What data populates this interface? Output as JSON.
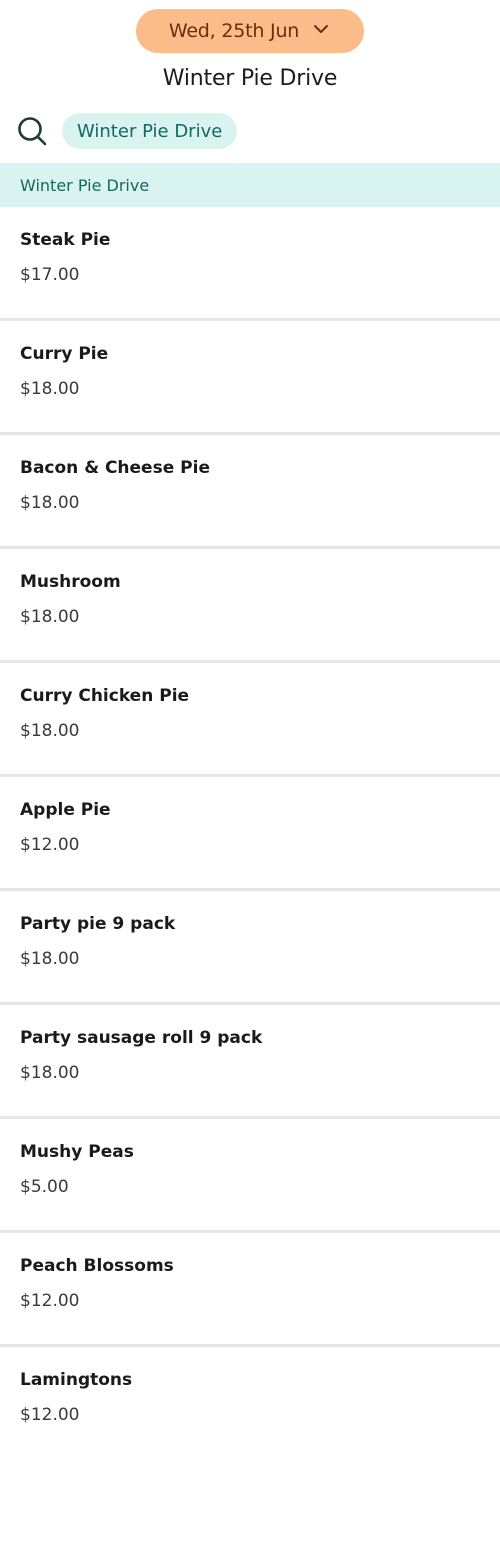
{
  "colors": {
    "date_pill_bg": "#fbbc8a",
    "date_pill_text": "#6b2e0c",
    "chip_bg": "#d8f3f0",
    "chip_text": "#16685e",
    "section_bg": "#d8f3f0",
    "section_text": "#16685e",
    "search_icon": "#1f3b36"
  },
  "header": {
    "date_label": "Wed, 25th Jun",
    "date_icon": "chevron-down-icon",
    "title": "Winter Pie Drive"
  },
  "search": {
    "icon": "search-icon",
    "active_chip": "Winter Pie Drive"
  },
  "menu": {
    "section_title": "Winter Pie Drive",
    "items": [
      {
        "name": "Steak Pie",
        "price": "$17.00"
      },
      {
        "name": "Curry Pie",
        "price": "$18.00"
      },
      {
        "name": "Bacon & Cheese Pie",
        "price": "$18.00"
      },
      {
        "name": "Mushroom",
        "price": "$18.00"
      },
      {
        "name": "Curry Chicken Pie",
        "price": "$18.00"
      },
      {
        "name": "Apple Pie",
        "price": "$12.00"
      },
      {
        "name": "Party pie 9 pack",
        "price": "$18.00"
      },
      {
        "name": "Party sausage roll 9 pack",
        "price": "$18.00"
      },
      {
        "name": "Mushy Peas",
        "price": "$5.00"
      },
      {
        "name": "Peach Blossoms",
        "price": "$12.00"
      },
      {
        "name": "Lamingtons",
        "price": "$12.00"
      }
    ]
  }
}
